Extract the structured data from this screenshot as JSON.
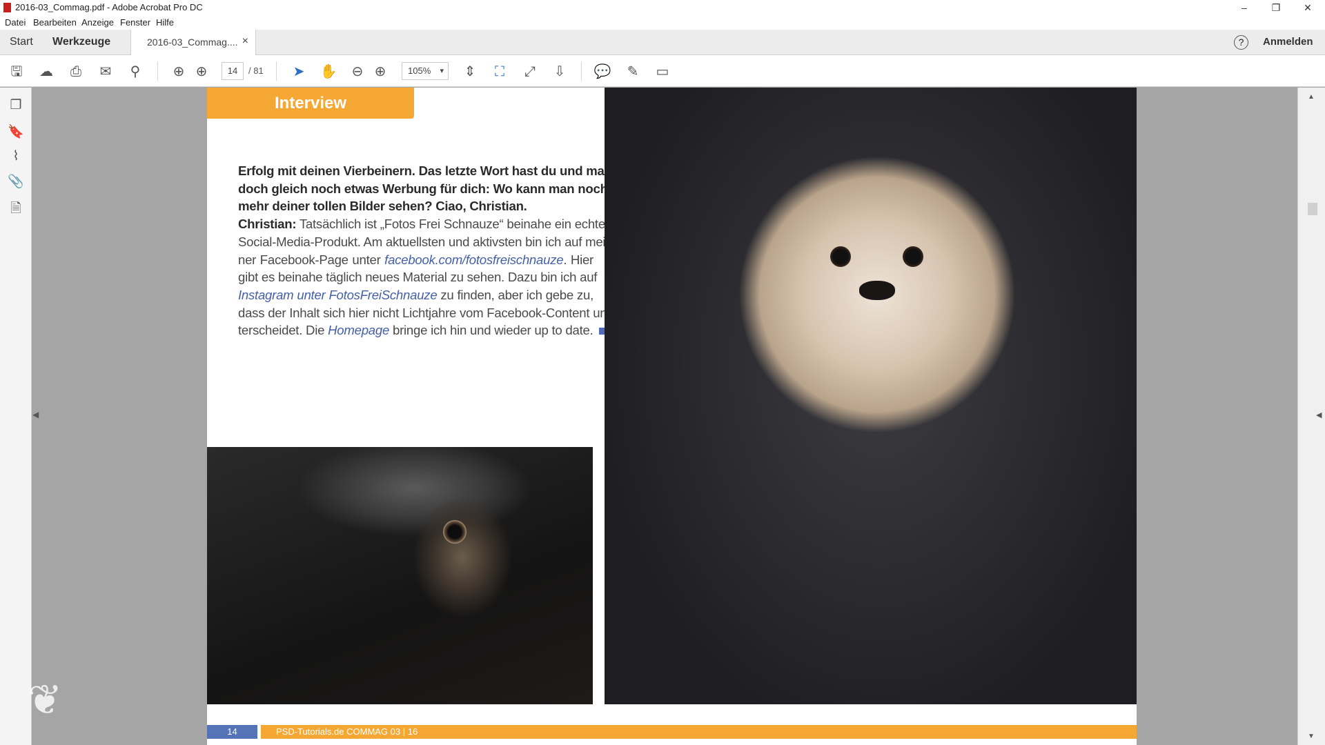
{
  "window": {
    "title": "2016-03_Commag.pdf - Adobe Acrobat Pro DC",
    "minimize": "–",
    "restore": "❐",
    "close": "✕"
  },
  "menu": [
    "Datei",
    "Bearbeiten",
    "Anzeige",
    "Fenster",
    "Hilfe"
  ],
  "tabs": {
    "start": "Start",
    "tools": "Werkzeuge",
    "document": "2016-03_Commag....",
    "close": "×",
    "help": "?",
    "signin": "Anmelden"
  },
  "toolbar": {
    "page_current": "14",
    "page_total": "/ 81",
    "zoom": "105%",
    "zoom_caret": "▾"
  },
  "document": {
    "section_tag": "Interview",
    "lines": [
      {
        "a": "Erfolg mit deinen Vierbeinern. Das letzte Wort hast du und mach"
      },
      {
        "a": "doch gleich noch etwas Werbung für dich: Wo kann man noch"
      },
      {
        "a": "mehr deiner tollen Bilder sehen? Ciao, Christian."
      },
      {
        "a": "Christian:",
        "b": " Tatsächlich ist „Fotos Frei Schnauze“ beinahe ein echtes"
      },
      {
        "a": "Social-Media-Produkt. Am aktuellsten und aktivsten bin ich auf mei-"
      },
      {
        "a": "ner Facebook-Page unter ",
        "link": "facebook.com/fotosfreischnauze",
        "b": ". Hier"
      },
      {
        "a": "gibt es beinahe täglich neues Material zu sehen. Dazu bin ich auf"
      },
      {
        "link": "Instagram unter FotosFreiSchnauze",
        "b": " zu finden, aber ich gebe zu,"
      },
      {
        "a": "dass der Inhalt sich hier nicht Lichtjahre vom Facebook-Content un-"
      },
      {
        "a": "terscheidet. Die ",
        "link": "Homepage",
        "b": " bringe ich hin und wieder up to date."
      }
    ],
    "footer_page": "14",
    "footer_text": "PSD-Tutorials.de   COMMAG 03 | 16"
  },
  "colors": {
    "accent_orange": "#f5a733",
    "footer_blue": "#5574b8",
    "link": "#4560a8"
  }
}
